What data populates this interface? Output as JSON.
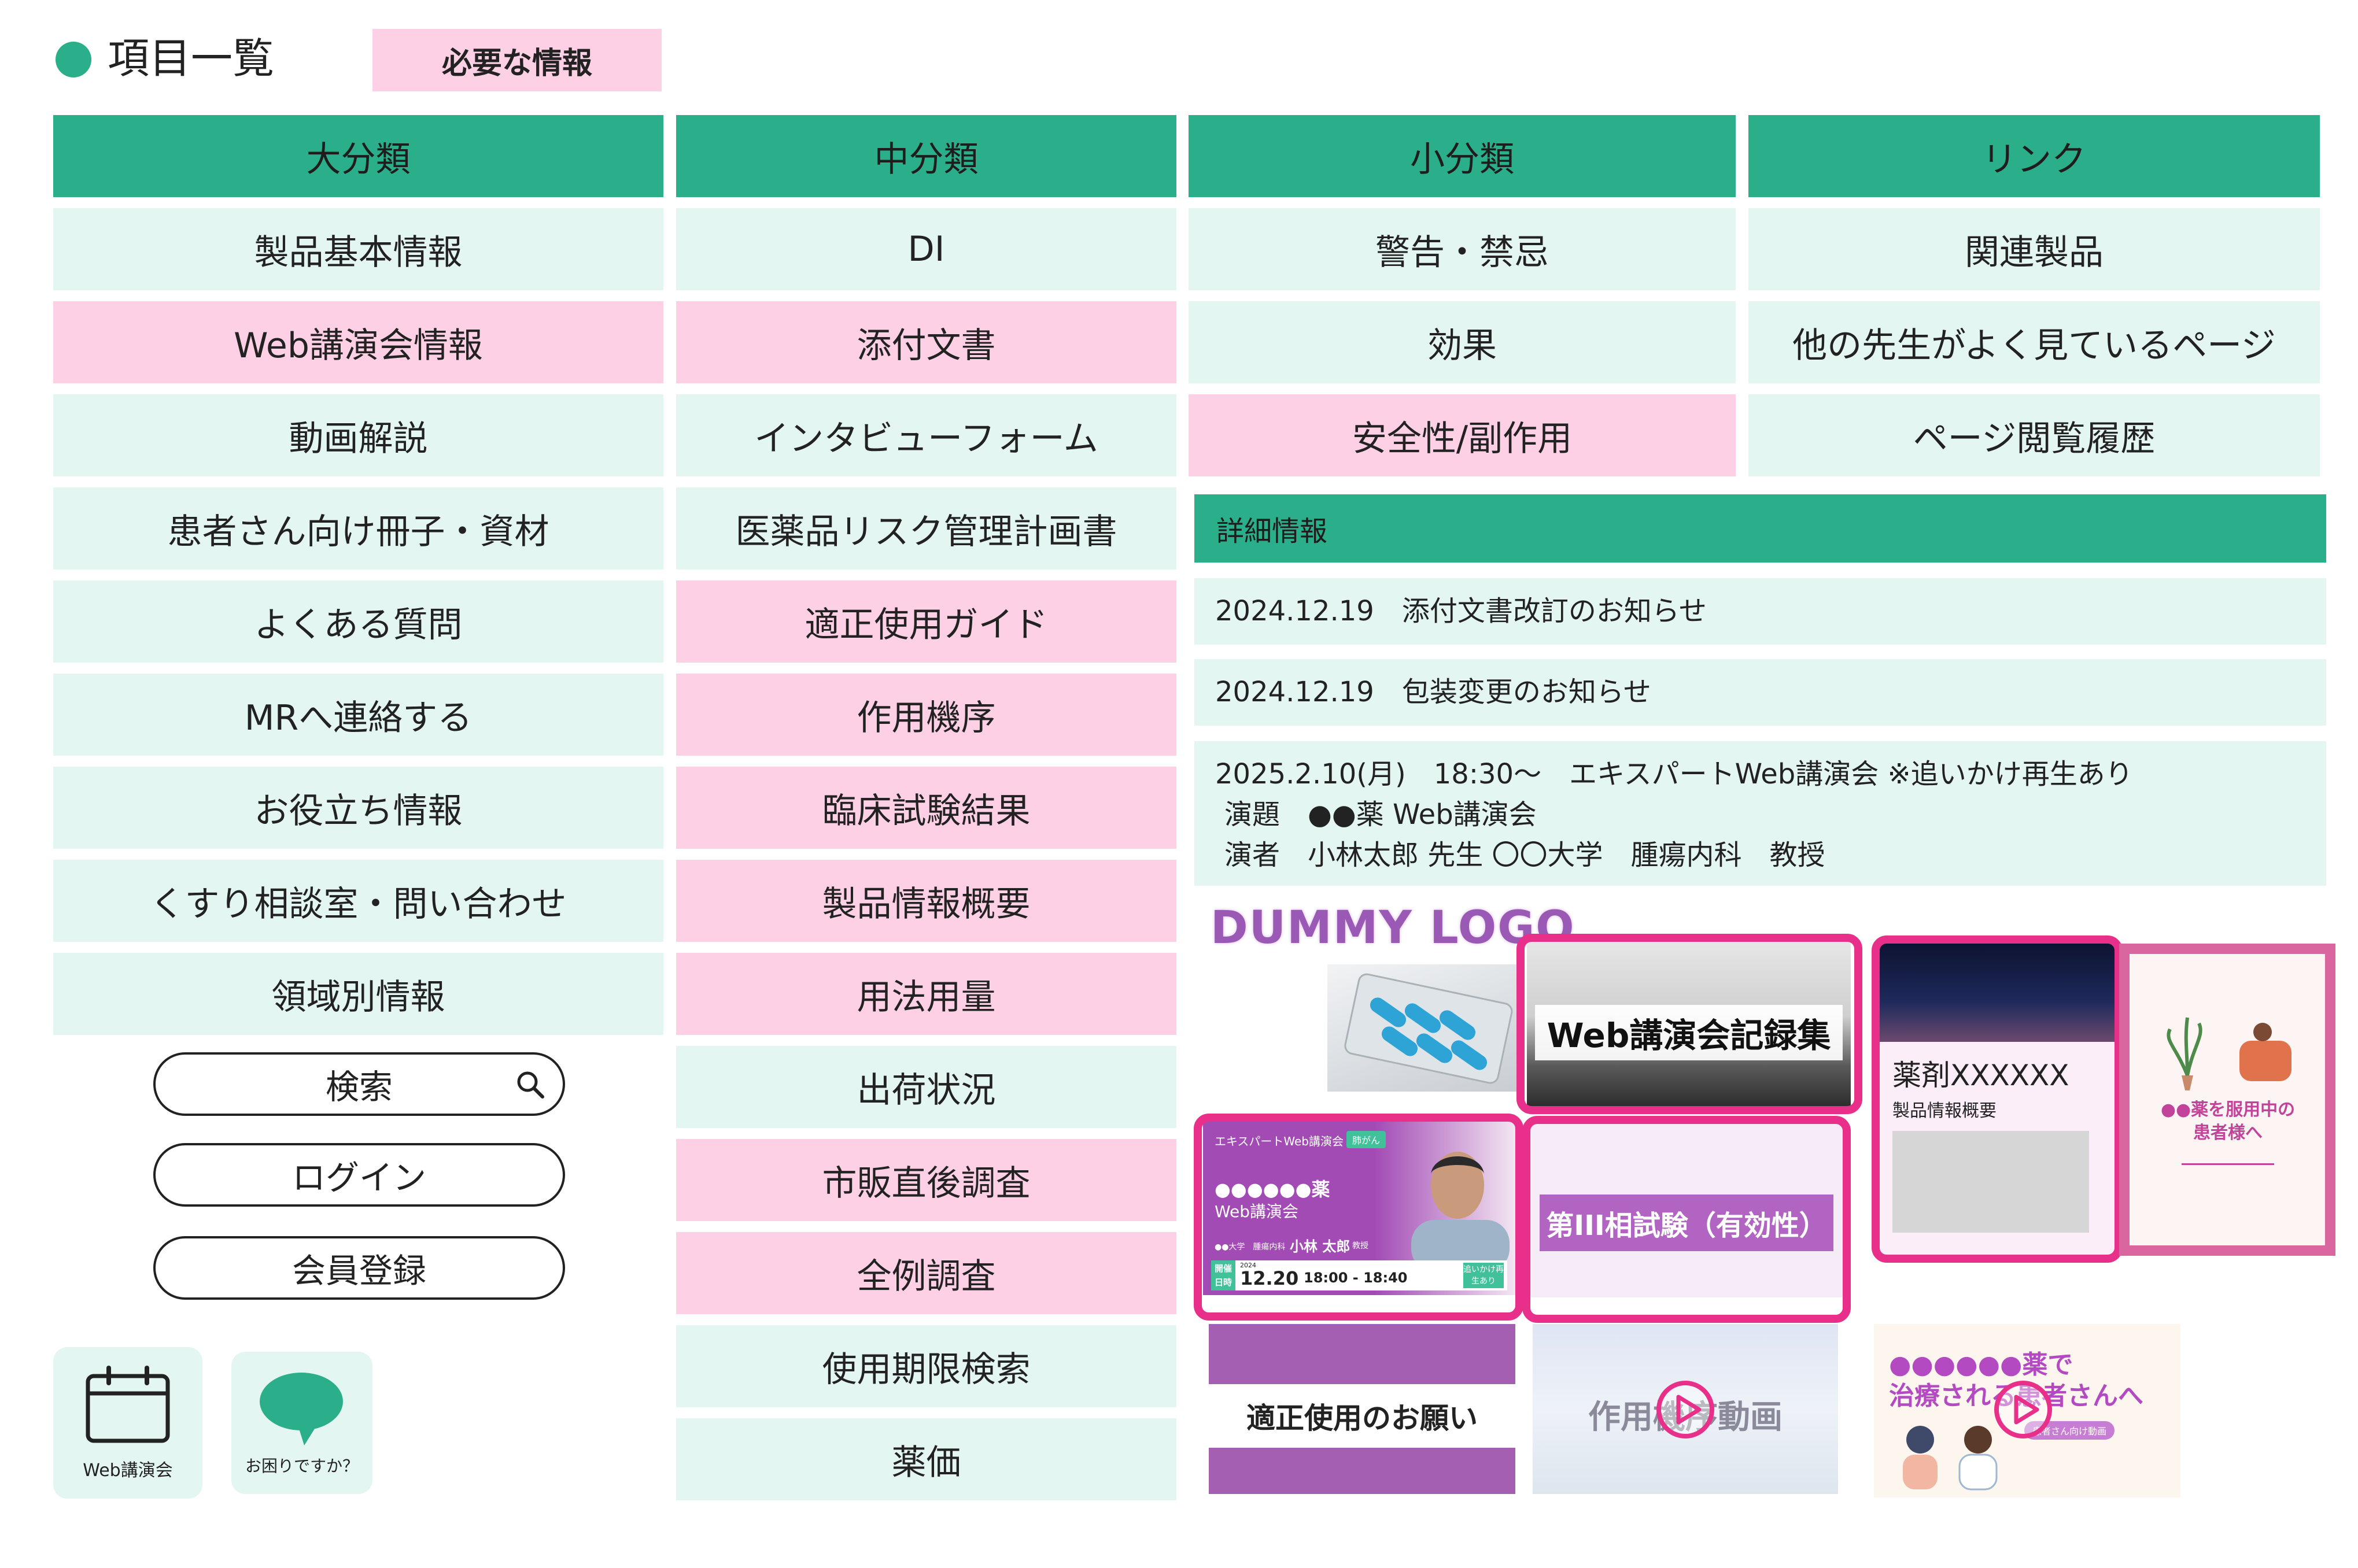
{
  "page": {
    "title": "項目一覧",
    "badge": "必要な情報",
    "accent": "#2bae8a",
    "mint": "#e4f6f1",
    "pink": "#fdd0e5",
    "magenta": "#e8308a"
  },
  "columns": {
    "headers": [
      "大分類",
      "中分類",
      "小分類",
      "リンク"
    ]
  },
  "large": {
    "items": [
      {
        "label": "製品基本情報",
        "highlight": false
      },
      {
        "label": "Web講演会情報",
        "highlight": true
      },
      {
        "label": "動画解説",
        "highlight": false
      },
      {
        "label": "患者さん向け冊子・資材",
        "highlight": false
      },
      {
        "label": "よくある質問",
        "highlight": false
      },
      {
        "label": "MRへ連絡する",
        "highlight": false
      },
      {
        "label": "お役立ち情報",
        "highlight": false
      },
      {
        "label": "くすり相談室・問い合わせ",
        "highlight": false
      },
      {
        "label": "領域別情報",
        "highlight": false
      }
    ]
  },
  "medium": {
    "items": [
      {
        "label": "DI",
        "highlight": false
      },
      {
        "label": "添付文書",
        "highlight": true
      },
      {
        "label": "インタビューフォーム",
        "highlight": false
      },
      {
        "label": "医薬品リスク管理計画書",
        "highlight": false
      },
      {
        "label": "適正使用ガイド",
        "highlight": true
      },
      {
        "label": "作用機序",
        "highlight": true
      },
      {
        "label": "臨床試験結果",
        "highlight": true
      },
      {
        "label": "製品情報概要",
        "highlight": true
      },
      {
        "label": "用法用量",
        "highlight": true
      },
      {
        "label": "出荷状況",
        "highlight": false
      },
      {
        "label": "市販直後調査",
        "highlight": true
      },
      {
        "label": "全例調査",
        "highlight": true
      },
      {
        "label": "使用期限検索",
        "highlight": false
      },
      {
        "label": "薬価",
        "highlight": false
      }
    ]
  },
  "small": {
    "items": [
      {
        "label": "警告・禁忌",
        "highlight": false
      },
      {
        "label": "効果",
        "highlight": false
      },
      {
        "label": "安全性/副作用",
        "highlight": true
      }
    ]
  },
  "links": {
    "items": [
      {
        "label": "関連製品",
        "highlight": false
      },
      {
        "label": "他の先生がよく見ているページ",
        "highlight": false
      },
      {
        "label": "ページ閲覧履歴",
        "highlight": false
      }
    ]
  },
  "actions": {
    "search_label": "検索",
    "login_label": "ログイン",
    "register_label": "会員登録",
    "search_icon": "search-icon"
  },
  "shortcuts": {
    "webinar_label": "Web講演会",
    "webinar_icon": "calendar-icon",
    "help_label": "お困りですか？",
    "help_icon": "chat-bubble-icon"
  },
  "details": {
    "header": "詳細情報",
    "news1": "2024.12.19　添付文書改訂のお知らせ",
    "news2": "2024.12.19　包装変更のお知らせ",
    "event_line1": "2025.2.10(月)　18:30～　エキスパートWeb講演会 ※追いかけ再生あり",
    "event_line2": "演題　●●薬 Web講演会",
    "event_line3": "演者　小林太郎 先生 〇〇大学　腫瘍内科　教授"
  },
  "media": {
    "logo": "DUMMY LOGO",
    "record_title": "Web講演会記録集",
    "drug_title": "薬剤XXXXXX",
    "drug_sub": "製品情報概要",
    "booklet_text": "●●薬を服用中の患者様へ",
    "webinar_banner": {
      "top": "エキスパートWeb講演会",
      "tag": "肺がん",
      "drug": "●●●●●●薬",
      "sub": "Web講演会",
      "speaker_org": "●●大学　腫瘍内科",
      "speaker": "小林 太郎",
      "speaker_title": "教授",
      "date_label": "開催日時",
      "year": "2024",
      "date": "12.20",
      "time": "18:00 - 18:40",
      "replay": "追いかけ再生あり"
    },
    "trial_title": "第III相試験（有効性）",
    "proper_use": "適正使用のお願い",
    "moa_video": "作用機序動画",
    "patient_video_line1": "●●●●●●薬で",
    "patient_video_line2": "治療される患者さんへ",
    "patient_video_tag": "患者さん向け動画"
  }
}
